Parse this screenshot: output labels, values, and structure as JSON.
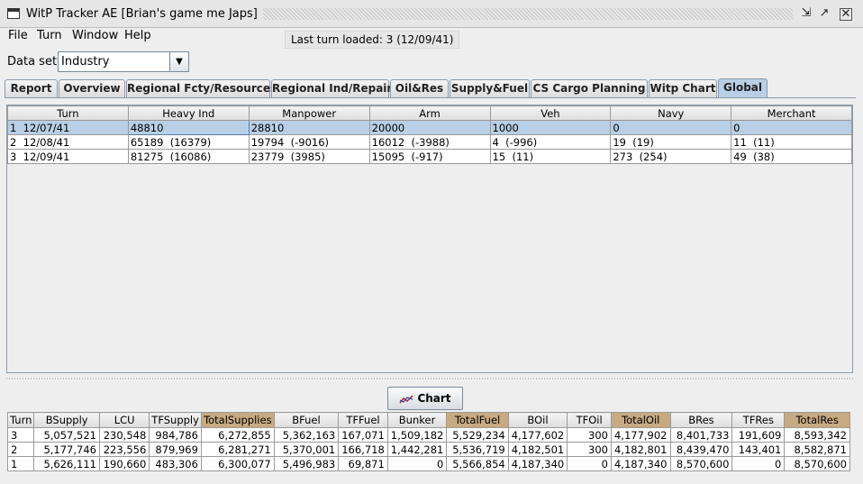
{
  "window": {
    "title": "WitP Tracker AE [Brian's game me Japs]"
  },
  "menu": [
    "File",
    "Turn",
    "Window",
    "Help"
  ],
  "status": {
    "last_turn": "Last turn loaded: 3 (12/09/41)"
  },
  "dataset": {
    "label": "Data set:",
    "value": "Industry"
  },
  "tabs": [
    "Report",
    "Overview",
    "Regional Fcty/Resources",
    "Regional Ind/Repair",
    "Oil&Res",
    "Supply&Fuel",
    "CS Cargo Planning",
    "Witp Chart",
    "Global"
  ],
  "active_tab": "Global",
  "top_table": {
    "columns": [
      "Turn",
      "Heavy Ind",
      "Manpower",
      "Arm",
      "Veh",
      "Navy",
      "Merchant"
    ],
    "rows": [
      [
        "1  12/07/41",
        "48810",
        "28810",
        "20000",
        "1000",
        "0",
        "0"
      ],
      [
        "2  12/08/41",
        "65189  (16379)",
        "19794  (-9016)",
        "16012  (-3988)",
        "4  (-996)",
        "19  (19)",
        "11  (11)"
      ],
      [
        "3  12/09/41",
        "81275  (16086)",
        "23779  (3985)",
        "15095  (-917)",
        "15  (11)",
        "273  (254)",
        "49  (38)"
      ]
    ]
  },
  "chart_button": {
    "label": "Chart"
  },
  "bottom_table": {
    "columns": [
      "Turn",
      "BSupply",
      "LCU",
      "TFSupply",
      "TotalSupplies",
      "BFuel",
      "TFFuel",
      "Bunker",
      "TotalFuel",
      "BOil",
      "TFOil",
      "TotalOil",
      "BRes",
      "TFRes",
      "TotalRes"
    ],
    "highlighted_columns": [
      "TotalSupplies",
      "TotalFuel",
      "TotalOil",
      "TotalRes"
    ],
    "highlight_color": "#c8aa82",
    "rows": [
      [
        "3",
        "5,057,521",
        "230,548",
        "984,786",
        "6,272,855",
        "5,362,163",
        "167,071",
        "1,509,182",
        "5,529,234",
        "4,177,602",
        "300",
        "4,177,902",
        "8,401,733",
        "191,609",
        "8,593,342"
      ],
      [
        "2",
        "5,177,746",
        "223,556",
        "879,969",
        "6,281,271",
        "5,370,001",
        "166,718",
        "1,442,281",
        "5,536,719",
        "4,182,501",
        "300",
        "4,182,801",
        "8,439,470",
        "143,401",
        "8,582,871"
      ],
      [
        "1",
        "5,626,111",
        "190,660",
        "483,306",
        "6,300,077",
        "5,496,983",
        "69,871",
        "0",
        "5,566,854",
        "4,187,340",
        "0",
        "4,187,340",
        "8,570,600",
        "0",
        "8,570,600"
      ]
    ]
  },
  "colors": {
    "selection": "#b8cfe5",
    "active_tab": "#b8cfe5"
  }
}
